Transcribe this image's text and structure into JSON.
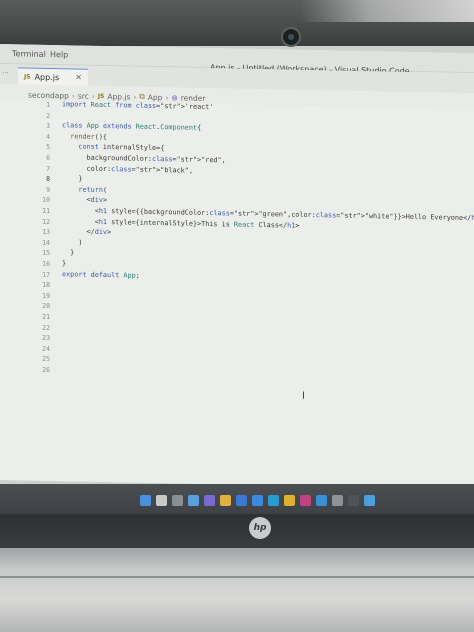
{
  "window": {
    "menu_terminal": "Terminal",
    "menu_help": "Help",
    "title": "App.js - Untitled (Workspace) - Visual Studio Code"
  },
  "tabs": [
    {
      "badge": "JS",
      "label": "App.js",
      "close": "×"
    }
  ],
  "breadcrumb": {
    "folder": "secondapp",
    "src": "src",
    "file_badge": "JS",
    "file": "App.js",
    "class": "App",
    "method": "render"
  },
  "editor": {
    "line_numbers": [
      "1",
      "2",
      "3",
      "4",
      "5",
      "6",
      "7",
      "8",
      "9",
      "10",
      "11",
      "12",
      "13",
      "14",
      "15",
      "16",
      "17",
      "18",
      "19",
      "20",
      "21",
      "22",
      "23",
      "24",
      "25",
      "26"
    ],
    "active_line": "8",
    "lines": [
      "import React from 'react'",
      "",
      "class App extends React.Component{",
      "  render(){",
      "    const internalStyle={",
      "      backgroundColor:\"red\",",
      "      color:\"black\",",
      "    }",
      "    return(",
      "      <div>",
      "        <h1 style={{backgroundColor:\"green\",color:\"white\"}}>Hello Everyone</h1>",
      "        <h1 style={internalStyle}>This is React Class</h1>",
      "      </div>",
      "    )",
      "  }",
      "}",
      "export default App;"
    ]
  },
  "colors": {
    "keyword": "#3b58a8",
    "string": "#a33a2a",
    "class": "#2a7d72",
    "editor_bg": "#eceeeb",
    "taskbar": "#3e4246"
  },
  "taskbar_icons": [
    "windows-start-icon",
    "search-icon",
    "task-view-icon",
    "widgets-icon",
    "chat-icon",
    "file-explorer-icon",
    "store-icon",
    "mail-icon",
    "edge-icon",
    "chrome-icon",
    "app-icon",
    "vscode-icon",
    "settings-icon",
    "terminal-icon",
    "vscode-active-icon"
  ],
  "laptop_brand": "hp"
}
